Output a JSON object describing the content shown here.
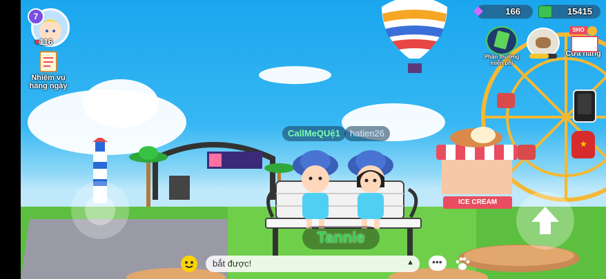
{
  "player": {
    "level": "7",
    "hearts": "116"
  },
  "currency": {
    "gems": "166",
    "cash": "15415"
  },
  "menu": {
    "daily_missions": "Nhiệm vụ\nhàng ngày",
    "free_rewards": "Phần thưởng\nmiễn phí",
    "shop": "Cửa hàng",
    "shop_sign": "SHO"
  },
  "players": [
    {
      "name": "CallMeQUệ1",
      "color": "#7dffb0"
    },
    {
      "name": "hatien26",
      "color": "#cfe6ff"
    }
  ],
  "nearby_label": "Tannie",
  "chat": {
    "input_text": "bắt được!"
  },
  "scenery": {
    "ice_cream_sign": "ICE CREAM"
  },
  "colors": {
    "accent_green": "#2fd24a",
    "sky": "#1aa6ee",
    "grass": "#5dbf3f"
  }
}
